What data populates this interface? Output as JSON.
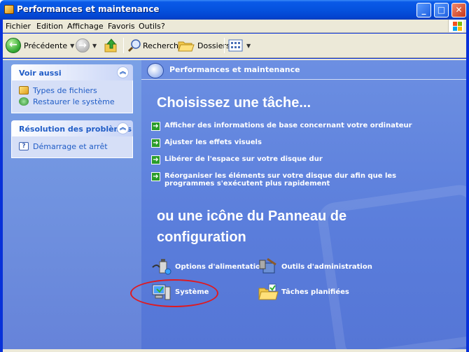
{
  "window": {
    "title": "Performances et maintenance",
    "min_glyph": "_",
    "max_glyph": "□",
    "close_glyph": "✕"
  },
  "menu": {
    "items": [
      "Fichier",
      "Edition",
      "Affichage",
      "Favoris",
      "Outils",
      "?"
    ]
  },
  "toolbar": {
    "back_label": "Précédente",
    "search_label": "Rechercher",
    "folders_label": "Dossiers"
  },
  "sidebar": {
    "see_also": {
      "title": "Voir aussi",
      "links": [
        "Types de fichiers",
        "Restaurer le système"
      ]
    },
    "troubleshooting": {
      "title": "Résolution des problèmes",
      "links": [
        "Démarrage et arrêt"
      ]
    }
  },
  "main": {
    "header": "Performances et maintenance",
    "pick_task": "Choisissez une tâche...",
    "tasks": [
      "Afficher des informations de base concernant votre ordinateur",
      "Ajuster les effets visuels",
      "Libérer de l'espace sur votre disque dur",
      "Réorganiser les éléments sur votre disque dur afin que les programmes s'exécutent plus rapidement"
    ],
    "or_icon_line1": "ou une icône du Panneau de",
    "or_icon_line2": "configuration",
    "icons": [
      "Options d'alimentation",
      "Outils d'administration",
      "Système",
      "Tâches planifiées"
    ]
  },
  "colors": {
    "task_arrow": "#2a9c2a",
    "highlight": "#e0191f",
    "link": "#215dc6"
  }
}
